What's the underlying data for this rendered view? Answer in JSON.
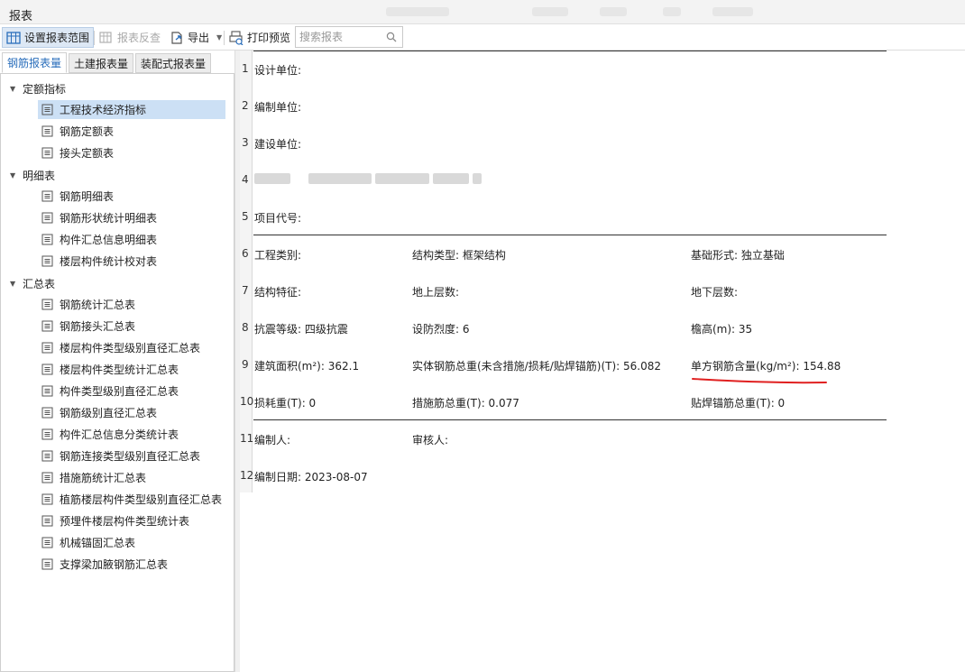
{
  "window": {
    "title": "报表"
  },
  "toolbar": {
    "set_range": "设置报表范围",
    "reverse_check": "报表反查",
    "export": "导出",
    "print_preview": "打印预览",
    "search_placeholder": "搜索报表"
  },
  "tabs": [
    "钢筋报表量",
    "土建报表量",
    "装配式报表量"
  ],
  "tree": {
    "groups": [
      {
        "label": "定额指标",
        "items": [
          "工程技术经济指标",
          "钢筋定额表",
          "接头定额表"
        ]
      },
      {
        "label": "明细表",
        "items": [
          "钢筋明细表",
          "钢筋形状统计明细表",
          "构件汇总信息明细表",
          "楼层构件统计校对表"
        ]
      },
      {
        "label": "汇总表",
        "items": [
          "钢筋统计汇总表",
          "钢筋接头汇总表",
          "楼层构件类型级别直径汇总表",
          "楼层构件类型统计汇总表",
          "构件类型级别直径汇总表",
          "钢筋级别直径汇总表",
          "构件汇总信息分类统计表",
          "钢筋连接类型级别直径汇总表",
          "措施筋统计汇总表",
          "植筋楼层构件类型级别直径汇总表",
          "预埋件楼层构件类型统计表",
          "机械锚固汇总表",
          "支撑梁加腋钢筋汇总表"
        ]
      }
    ]
  },
  "report": {
    "row_numbers": [
      "1",
      "2",
      "3",
      "4",
      "5",
      "6",
      "7",
      "8",
      "9",
      "10",
      "11",
      "12"
    ],
    "design_unit": "设计单位:",
    "compile_unit": "编制单位:",
    "build_unit": "建设单位:",
    "project_code": "项目代号:",
    "project_type": "工程类别:",
    "structure_type": "结构类型: 框架结构",
    "foundation_type": "基础形式: 独立基础",
    "structure_feature": "结构特征:",
    "floors_above": "地上层数:",
    "floors_below": "地下层数:",
    "seismic_grade": "抗震等级: 四级抗震",
    "fortification_intensity": "设防烈度: 6",
    "eave_height": "檐高(m): 35",
    "building_area": "建筑面积(m²): 362.1",
    "total_rebar": "实体钢筋总重(未含措施/损耗/贴焊锚筋)(T): 56.082",
    "unit_rebar": "单方钢筋含量(kg/m²): 154.88",
    "loss_weight": "损耗重(T): 0",
    "measure_rebar": "措施筋总重(T): 0.077",
    "welded_anchor": "贴焊锚筋总重(T): 0",
    "compiler": "编制人:",
    "reviewer": "审核人:",
    "compile_date": "编制日期: 2023-08-07"
  },
  "colors": {
    "accent": "#2a6ebb",
    "annotation": "#e02020",
    "selected_bg": "#cce0f5"
  }
}
